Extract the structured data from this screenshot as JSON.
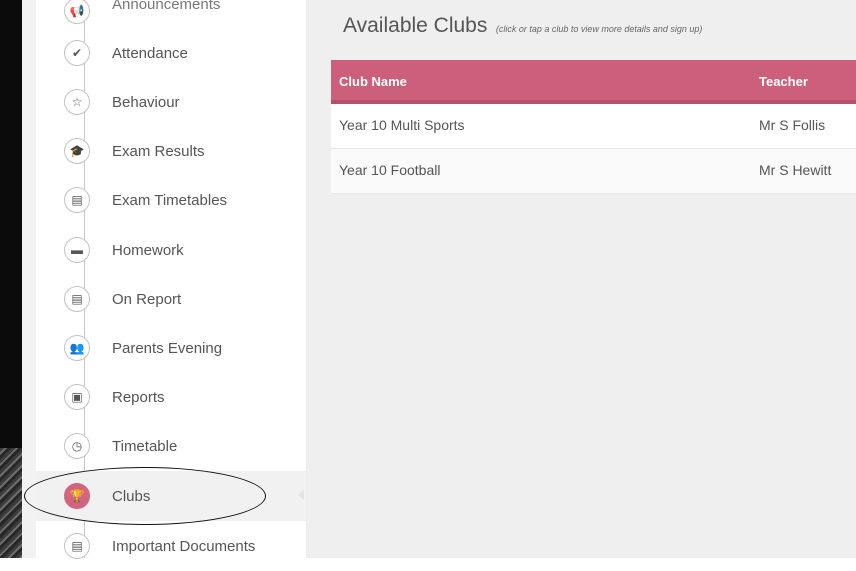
{
  "sidebar": {
    "items": [
      {
        "label": "Announcements",
        "icon": "announcement-icon",
        "glyph": "📢"
      },
      {
        "label": "Attendance",
        "icon": "check-icon",
        "glyph": "✔"
      },
      {
        "label": "Behaviour",
        "icon": "star-icon",
        "glyph": "☆"
      },
      {
        "label": "Exam Results",
        "icon": "graduation-cap-icon",
        "glyph": "🎓"
      },
      {
        "label": "Exam Timetables",
        "icon": "calendar-icon",
        "glyph": "▤"
      },
      {
        "label": "Homework",
        "icon": "briefcase-icon",
        "glyph": "▬"
      },
      {
        "label": "On Report",
        "icon": "document-icon",
        "glyph": "▤"
      },
      {
        "label": "Parents Evening",
        "icon": "users-icon",
        "glyph": "👥"
      },
      {
        "label": "Reports",
        "icon": "file-icon",
        "glyph": "▣"
      },
      {
        "label": "Timetable",
        "icon": "clock-icon",
        "glyph": "◷"
      },
      {
        "label": "Clubs",
        "icon": "trophy-icon",
        "glyph": "🏆"
      },
      {
        "label": "Important Documents",
        "icon": "document-icon",
        "glyph": "▤"
      }
    ],
    "active_item": "Clubs"
  },
  "main": {
    "title": "Available Clubs",
    "subtitle": "(click or tap a club to view more details and sign up)",
    "table": {
      "headers": [
        "Club Name",
        "Teacher"
      ],
      "rows": [
        {
          "club": "Year 10 Multi Sports",
          "teacher": "Mr S Follis"
        },
        {
          "club": "Year 10 Football",
          "teacher": "Mr S Hewitt"
        }
      ]
    }
  },
  "colors": {
    "accent": "#cb5f7c",
    "active_circle": "#d1647f",
    "annotation_ellipse": "#111111"
  }
}
